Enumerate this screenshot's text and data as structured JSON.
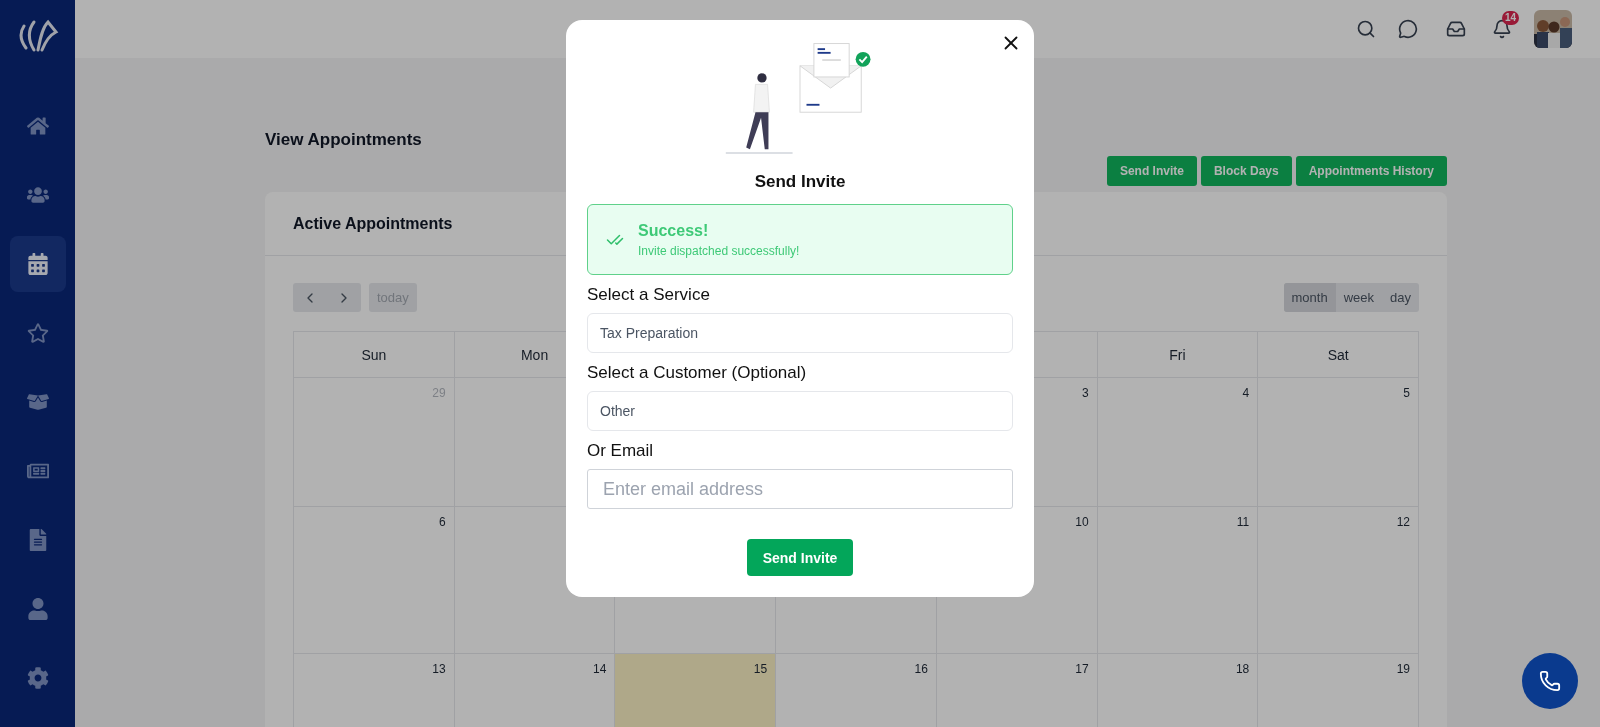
{
  "sidebar": {
    "items": [
      {
        "selected": false
      },
      {
        "selected": false
      },
      {
        "selected": true
      },
      {
        "selected": false
      },
      {
        "selected": false
      },
      {
        "selected": false
      },
      {
        "selected": false
      },
      {
        "selected": false
      },
      {
        "selected": false
      }
    ]
  },
  "topbar": {
    "notification_count": "14"
  },
  "page": {
    "title": "View Appointments",
    "actions": [
      "Send Invite",
      "Block Days",
      "Appointments History"
    ]
  },
  "calendar": {
    "title": "Active Appointments",
    "today_button": {
      "label": "today",
      "disabled": true
    },
    "views": [
      {
        "label": "month",
        "selected": true
      },
      {
        "label": "week",
        "selected": false
      },
      {
        "label": "day",
        "selected": false
      }
    ],
    "weekdays": [
      "Sun",
      "Mon",
      "Fri",
      "Sat"
    ],
    "weeks": [
      [
        {
          "date": "29",
          "outside": true,
          "today": false
        },
        {
          "today": false
        },
        {
          "date": "3",
          "outside": false,
          "today": false
        },
        {
          "date": "4",
          "outside": false,
          "today": false
        },
        {
          "date": "5",
          "outside": false,
          "today": false
        }
      ],
      [
        {
          "date": "6",
          "outside": false,
          "today": false
        },
        {
          "today": false
        },
        {
          "today": false
        },
        {
          "today": false
        },
        {
          "date": "10",
          "outside": false,
          "today": false
        },
        {
          "date": "11",
          "outside": false,
          "today": false
        },
        {
          "date": "12",
          "outside": false,
          "today": false
        }
      ],
      [
        {
          "date": "13",
          "outside": false,
          "today": false
        },
        {
          "date": "14",
          "outside": false,
          "today": false
        },
        {
          "date": "15",
          "outside": false,
          "today": true
        },
        {
          "date": "16",
          "outside": false,
          "today": false
        },
        {
          "date": "17",
          "outside": false,
          "today": false
        },
        {
          "date": "18",
          "outside": false,
          "today": false
        },
        {
          "date": "19",
          "outside": false,
          "today": false
        }
      ]
    ]
  },
  "modal": {
    "title": "Send Invite",
    "alert": {
      "title": "Success!",
      "message": "Invite dispatched successfully!"
    },
    "fields": [
      {
        "kind": "select",
        "label": "Select a Service",
        "value": "Tax Preparation"
      },
      {
        "kind": "select",
        "label": "Select a Customer (Optional)",
        "value": "Other"
      },
      {
        "kind": "input",
        "label": "Or Email",
        "placeholder": "Enter email address"
      }
    ],
    "submit": "Send Invite"
  }
}
